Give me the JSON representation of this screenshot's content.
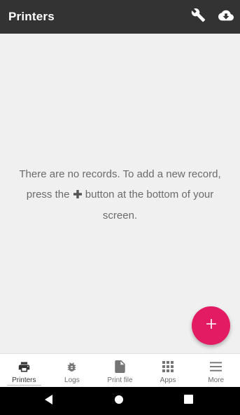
{
  "app_bar": {
    "title": "Printers",
    "actions": [
      {
        "icon": "wrench-icon"
      },
      {
        "icon": "cloud-download-icon"
      }
    ]
  },
  "empty_state": {
    "text_before_icon": "There are no records. To add a new record, press the",
    "icon": "plus-icon",
    "text_after_icon": "button at the bottom of your screen."
  },
  "fab": {
    "icon": "plus-icon"
  },
  "bottom_nav": {
    "active_index": 0,
    "items": [
      {
        "label": "Printers",
        "icon": "printer-icon"
      },
      {
        "label": "Logs",
        "icon": "bug-icon"
      },
      {
        "label": "Print file",
        "icon": "file-icon"
      },
      {
        "label": "Apps",
        "icon": "apps-grid-icon"
      },
      {
        "label": "More",
        "icon": "menu-icon"
      }
    ]
  },
  "system_nav": {
    "buttons": [
      "back-icon",
      "home-icon",
      "recents-icon"
    ]
  },
  "colors": {
    "app_bar": "#333333",
    "background": "#f0f0f0",
    "fab": "#e31b63",
    "text_secondary": "#6b6b6b"
  }
}
